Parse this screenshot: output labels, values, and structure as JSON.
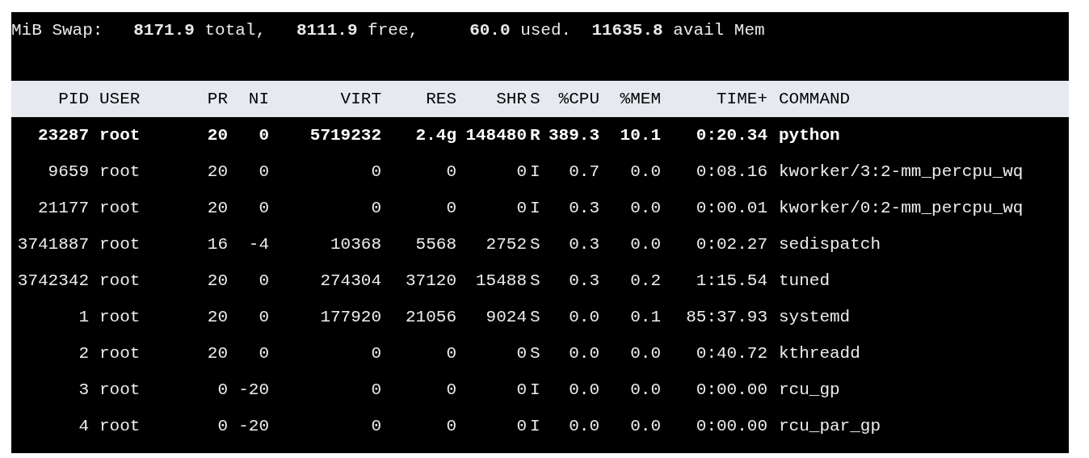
{
  "swap_line": "MiB Swap:   **8171.9** total,   **8111.9** free,     **60.0** used.  **11635.8** avail Mem",
  "table": {
    "columns": [
      "PID",
      "USER",
      "PR",
      "NI",
      "VIRT",
      "RES",
      "SHR",
      "S",
      "%CPU",
      "%MEM",
      "TIME+",
      "COMMAND"
    ],
    "rows": [
      {
        "highlighted": true,
        "cells": [
          "23287",
          "root",
          "20",
          "0",
          "5719232",
          "2.4g",
          "148480",
          "R",
          "389.3",
          "10.1",
          "0:20.34",
          "python"
        ]
      },
      {
        "highlighted": false,
        "cells": [
          "9659",
          "root",
          "20",
          "0",
          "0",
          "0",
          "0",
          "I",
          "0.7",
          "0.0",
          "0:08.16",
          "kworker/3:2-mm_percpu_wq"
        ]
      },
      {
        "highlighted": false,
        "cells": [
          "21177",
          "root",
          "20",
          "0",
          "0",
          "0",
          "0",
          "I",
          "0.3",
          "0.0",
          "0:00.01",
          "kworker/0:2-mm_percpu_wq"
        ]
      },
      {
        "highlighted": false,
        "cells": [
          "3741887",
          "root",
          "16",
          "-4",
          "10368",
          "5568",
          "2752",
          "S",
          "0.3",
          "0.0",
          "0:02.27",
          "sedispatch"
        ]
      },
      {
        "highlighted": false,
        "cells": [
          "3742342",
          "root",
          "20",
          "0",
          "274304",
          "37120",
          "15488",
          "S",
          "0.3",
          "0.2",
          "1:15.54",
          "tuned"
        ]
      },
      {
        "highlighted": false,
        "cells": [
          "1",
          "root",
          "20",
          "0",
          "177920",
          "21056",
          "9024",
          "S",
          "0.0",
          "0.1",
          "85:37.93",
          "systemd"
        ]
      },
      {
        "highlighted": false,
        "cells": [
          "2",
          "root",
          "20",
          "0",
          "0",
          "0",
          "0",
          "S",
          "0.0",
          "0.0",
          "0:40.72",
          "kthreadd"
        ]
      },
      {
        "highlighted": false,
        "cells": [
          "3",
          "root",
          "0",
          "-20",
          "0",
          "0",
          "0",
          "I",
          "0.0",
          "0.0",
          "0:00.00",
          "rcu_gp"
        ]
      },
      {
        "highlighted": false,
        "cells": [
          "4",
          "root",
          "0",
          "-20",
          "0",
          "0",
          "0",
          "I",
          "0.0",
          "0.0",
          "0:00.00",
          "rcu_par_gp"
        ]
      }
    ]
  }
}
